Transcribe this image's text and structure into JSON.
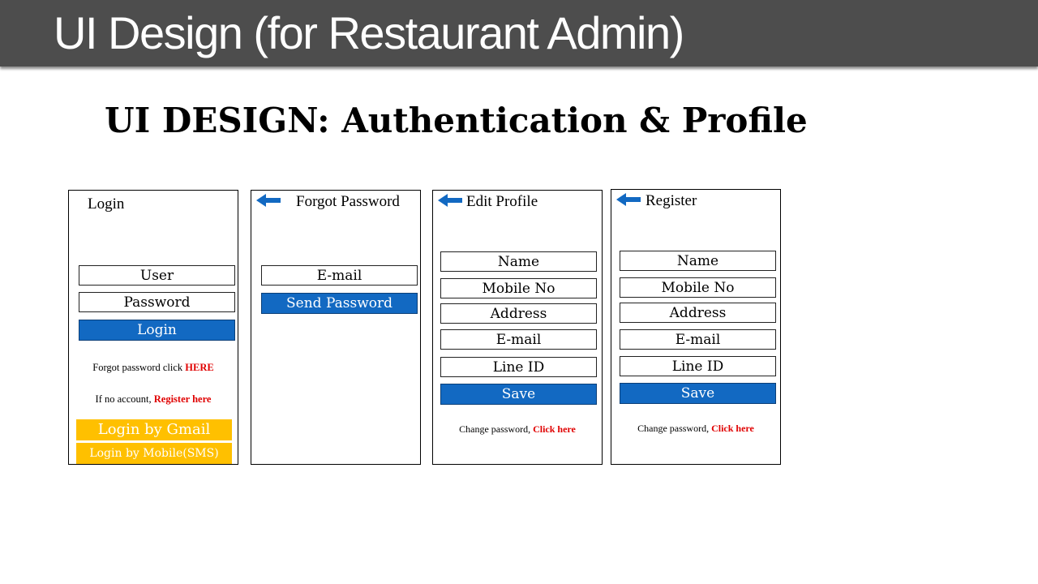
{
  "header": {
    "title": "UI Design (for Restaurant Admin)"
  },
  "subtitle": "UI DESIGN: Authentication & Profile",
  "colors": {
    "header_bg": "#4d4d4d",
    "primary_blue": "#1269c2",
    "accent_yellow": "#ffc000",
    "link_red": "#e00000",
    "arrow_blue": "#1269c2"
  },
  "screens": {
    "login": {
      "title": "Login",
      "user_field": "User",
      "password_field": "Password",
      "login_button": "Login",
      "forgot_text": "Forgot password click ",
      "forgot_link": "HERE",
      "register_text": "If no account, ",
      "register_link": "Register here",
      "gmail_button": "Login by Gmail",
      "mobile_button": "Login by Mobile(SMS)"
    },
    "forgot": {
      "back_icon": "arrow-left-icon",
      "title": "Forgot Password",
      "email_field": "E-mail",
      "send_button": "Send Password"
    },
    "edit_profile": {
      "back_icon": "arrow-left-icon",
      "title": "Edit Profile",
      "fields": [
        "Name",
        "Mobile No",
        "Address",
        "E-mail",
        "Line ID"
      ],
      "save_button": "Save",
      "change_text": "Change password, ",
      "change_link": "Click here"
    },
    "register": {
      "back_icon": "arrow-left-icon",
      "title": "Register",
      "fields": [
        "Name",
        "Mobile No",
        "Address",
        "E-mail",
        "Line ID"
      ],
      "save_button": "Save",
      "change_text": "Change password, ",
      "change_link": "Click here"
    }
  }
}
